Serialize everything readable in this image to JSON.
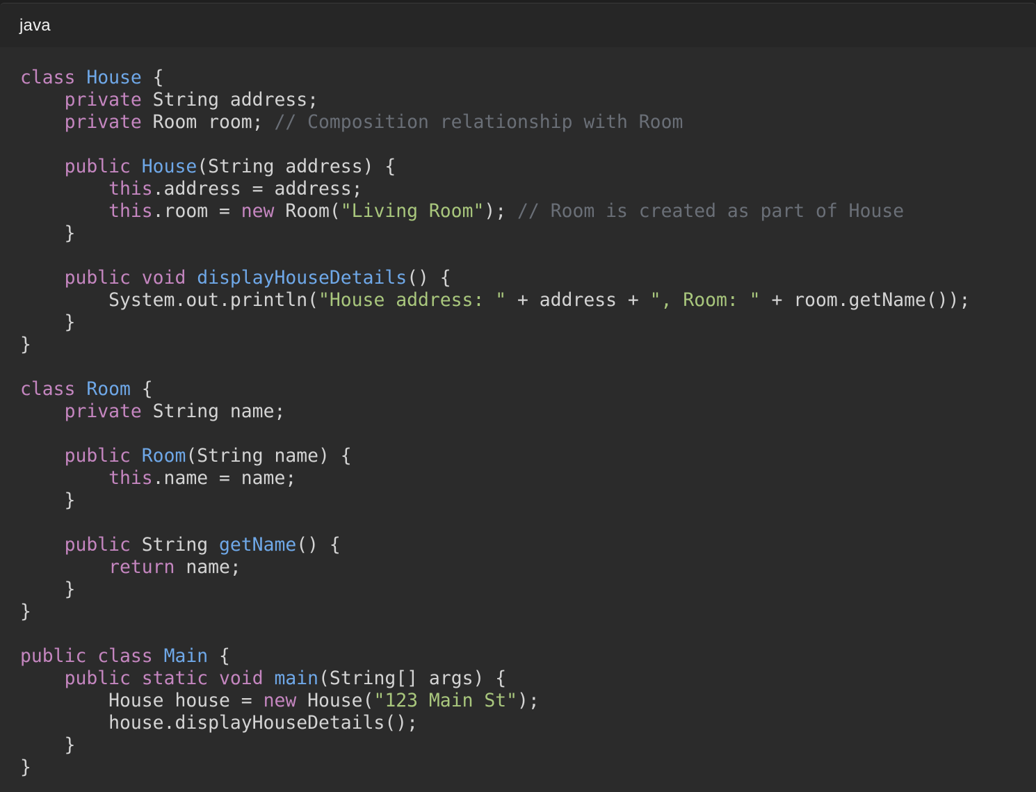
{
  "header": {
    "language": "java"
  },
  "colors": {
    "keyword": "#c586c0",
    "type_name": "#6fa8e8",
    "string": "#a9c77d",
    "comment": "#6a6f77",
    "plain": "#d4d4d4",
    "background": "#2b2b2b",
    "header_background": "#262626"
  },
  "code": {
    "lines": [
      [
        [
          "kw",
          "class"
        ],
        [
          "pl",
          " "
        ],
        [
          "ty",
          "House"
        ],
        [
          "pl",
          " {"
        ]
      ],
      [
        [
          "pl",
          "    "
        ],
        [
          "kw",
          "private"
        ],
        [
          "pl",
          " String address;"
        ]
      ],
      [
        [
          "pl",
          "    "
        ],
        [
          "kw",
          "private"
        ],
        [
          "pl",
          " Room room; "
        ],
        [
          "com",
          "// Composition relationship with Room"
        ]
      ],
      [],
      [
        [
          "pl",
          "    "
        ],
        [
          "kw",
          "public"
        ],
        [
          "pl",
          " "
        ],
        [
          "fn",
          "House"
        ],
        [
          "pl",
          "(String address) {"
        ]
      ],
      [
        [
          "pl",
          "        "
        ],
        [
          "kw",
          "this"
        ],
        [
          "pl",
          ".address = address;"
        ]
      ],
      [
        [
          "pl",
          "        "
        ],
        [
          "kw",
          "this"
        ],
        [
          "pl",
          ".room = "
        ],
        [
          "kw",
          "new"
        ],
        [
          "pl",
          " Room("
        ],
        [
          "str",
          "\"Living Room\""
        ],
        [
          "pl",
          "); "
        ],
        [
          "com",
          "// Room is created as part of House"
        ]
      ],
      [
        [
          "pl",
          "    }"
        ]
      ],
      [],
      [
        [
          "pl",
          "    "
        ],
        [
          "kw",
          "public"
        ],
        [
          "pl",
          " "
        ],
        [
          "kw",
          "void"
        ],
        [
          "pl",
          " "
        ],
        [
          "fn",
          "displayHouseDetails"
        ],
        [
          "pl",
          "() {"
        ]
      ],
      [
        [
          "pl",
          "        System.out.println("
        ],
        [
          "str",
          "\"House address: \""
        ],
        [
          "pl",
          " + address + "
        ],
        [
          "str",
          "\", Room: \""
        ],
        [
          "pl",
          " + room.getName());"
        ]
      ],
      [
        [
          "pl",
          "    }"
        ]
      ],
      [
        [
          "pl",
          "}"
        ]
      ],
      [],
      [
        [
          "kw",
          "class"
        ],
        [
          "pl",
          " "
        ],
        [
          "ty",
          "Room"
        ],
        [
          "pl",
          " {"
        ]
      ],
      [
        [
          "pl",
          "    "
        ],
        [
          "kw",
          "private"
        ],
        [
          "pl",
          " String name;"
        ]
      ],
      [],
      [
        [
          "pl",
          "    "
        ],
        [
          "kw",
          "public"
        ],
        [
          "pl",
          " "
        ],
        [
          "fn",
          "Room"
        ],
        [
          "pl",
          "(String name) {"
        ]
      ],
      [
        [
          "pl",
          "        "
        ],
        [
          "kw",
          "this"
        ],
        [
          "pl",
          ".name = name;"
        ]
      ],
      [
        [
          "pl",
          "    }"
        ]
      ],
      [],
      [
        [
          "pl",
          "    "
        ],
        [
          "kw",
          "public"
        ],
        [
          "pl",
          " String "
        ],
        [
          "fn",
          "getName"
        ],
        [
          "pl",
          "() {"
        ]
      ],
      [
        [
          "pl",
          "        "
        ],
        [
          "kw",
          "return"
        ],
        [
          "pl",
          " name;"
        ]
      ],
      [
        [
          "pl",
          "    }"
        ]
      ],
      [
        [
          "pl",
          "}"
        ]
      ],
      [],
      [
        [
          "kw",
          "public"
        ],
        [
          "pl",
          " "
        ],
        [
          "kw",
          "class"
        ],
        [
          "pl",
          " "
        ],
        [
          "ty",
          "Main"
        ],
        [
          "pl",
          " {"
        ]
      ],
      [
        [
          "pl",
          "    "
        ],
        [
          "kw",
          "public"
        ],
        [
          "pl",
          " "
        ],
        [
          "kw",
          "static"
        ],
        [
          "pl",
          " "
        ],
        [
          "kw",
          "void"
        ],
        [
          "pl",
          " "
        ],
        [
          "fn",
          "main"
        ],
        [
          "pl",
          "(String[] args) {"
        ]
      ],
      [
        [
          "pl",
          "        House house = "
        ],
        [
          "kw",
          "new"
        ],
        [
          "pl",
          " House("
        ],
        [
          "str",
          "\"123 Main St\""
        ],
        [
          "pl",
          ");"
        ]
      ],
      [
        [
          "pl",
          "        house.displayHouseDetails();"
        ]
      ],
      [
        [
          "pl",
          "    }"
        ]
      ],
      [
        [
          "pl",
          "}"
        ]
      ]
    ]
  }
}
